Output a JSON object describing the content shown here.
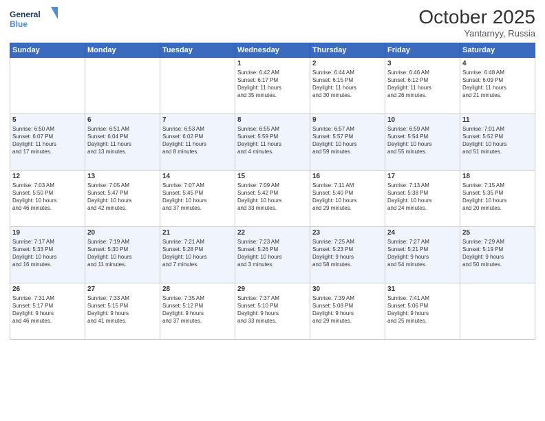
{
  "header": {
    "logo_line1": "General",
    "logo_line2": "Blue",
    "month": "October 2025",
    "location": "Yantarnyy, Russia"
  },
  "days_of_week": [
    "Sunday",
    "Monday",
    "Tuesday",
    "Wednesday",
    "Thursday",
    "Friday",
    "Saturday"
  ],
  "weeks": [
    [
      {
        "num": "",
        "info": ""
      },
      {
        "num": "",
        "info": ""
      },
      {
        "num": "",
        "info": ""
      },
      {
        "num": "1",
        "info": "Sunrise: 6:42 AM\nSunset: 6:17 PM\nDaylight: 11 hours\nand 35 minutes."
      },
      {
        "num": "2",
        "info": "Sunrise: 6:44 AM\nSunset: 6:15 PM\nDaylight: 11 hours\nand 30 minutes."
      },
      {
        "num": "3",
        "info": "Sunrise: 6:46 AM\nSunset: 6:12 PM\nDaylight: 11 hours\nand 26 minutes."
      },
      {
        "num": "4",
        "info": "Sunrise: 6:48 AM\nSunset: 6:09 PM\nDaylight: 11 hours\nand 21 minutes."
      }
    ],
    [
      {
        "num": "5",
        "info": "Sunrise: 6:50 AM\nSunset: 6:07 PM\nDaylight: 11 hours\nand 17 minutes."
      },
      {
        "num": "6",
        "info": "Sunrise: 6:51 AM\nSunset: 6:04 PM\nDaylight: 11 hours\nand 13 minutes."
      },
      {
        "num": "7",
        "info": "Sunrise: 6:53 AM\nSunset: 6:02 PM\nDaylight: 11 hours\nand 8 minutes."
      },
      {
        "num": "8",
        "info": "Sunrise: 6:55 AM\nSunset: 5:59 PM\nDaylight: 11 hours\nand 4 minutes."
      },
      {
        "num": "9",
        "info": "Sunrise: 6:57 AM\nSunset: 5:57 PM\nDaylight: 10 hours\nand 59 minutes."
      },
      {
        "num": "10",
        "info": "Sunrise: 6:59 AM\nSunset: 5:54 PM\nDaylight: 10 hours\nand 55 minutes."
      },
      {
        "num": "11",
        "info": "Sunrise: 7:01 AM\nSunset: 5:52 PM\nDaylight: 10 hours\nand 51 minutes."
      }
    ],
    [
      {
        "num": "12",
        "info": "Sunrise: 7:03 AM\nSunset: 5:50 PM\nDaylight: 10 hours\nand 46 minutes."
      },
      {
        "num": "13",
        "info": "Sunrise: 7:05 AM\nSunset: 5:47 PM\nDaylight: 10 hours\nand 42 minutes."
      },
      {
        "num": "14",
        "info": "Sunrise: 7:07 AM\nSunset: 5:45 PM\nDaylight: 10 hours\nand 37 minutes."
      },
      {
        "num": "15",
        "info": "Sunrise: 7:09 AM\nSunset: 5:42 PM\nDaylight: 10 hours\nand 33 minutes."
      },
      {
        "num": "16",
        "info": "Sunrise: 7:11 AM\nSunset: 5:40 PM\nDaylight: 10 hours\nand 29 minutes."
      },
      {
        "num": "17",
        "info": "Sunrise: 7:13 AM\nSunset: 5:38 PM\nDaylight: 10 hours\nand 24 minutes."
      },
      {
        "num": "18",
        "info": "Sunrise: 7:15 AM\nSunset: 5:35 PM\nDaylight: 10 hours\nand 20 minutes."
      }
    ],
    [
      {
        "num": "19",
        "info": "Sunrise: 7:17 AM\nSunset: 5:33 PM\nDaylight: 10 hours\nand 16 minutes."
      },
      {
        "num": "20",
        "info": "Sunrise: 7:19 AM\nSunset: 5:30 PM\nDaylight: 10 hours\nand 11 minutes."
      },
      {
        "num": "21",
        "info": "Sunrise: 7:21 AM\nSunset: 5:28 PM\nDaylight: 10 hours\nand 7 minutes."
      },
      {
        "num": "22",
        "info": "Sunrise: 7:23 AM\nSunset: 5:26 PM\nDaylight: 10 hours\nand 3 minutes."
      },
      {
        "num": "23",
        "info": "Sunrise: 7:25 AM\nSunset: 5:23 PM\nDaylight: 9 hours\nand 58 minutes."
      },
      {
        "num": "24",
        "info": "Sunrise: 7:27 AM\nSunset: 5:21 PM\nDaylight: 9 hours\nand 54 minutes."
      },
      {
        "num": "25",
        "info": "Sunrise: 7:29 AM\nSunset: 5:19 PM\nDaylight: 9 hours\nand 50 minutes."
      }
    ],
    [
      {
        "num": "26",
        "info": "Sunrise: 7:31 AM\nSunset: 5:17 PM\nDaylight: 9 hours\nand 46 minutes."
      },
      {
        "num": "27",
        "info": "Sunrise: 7:33 AM\nSunset: 5:15 PM\nDaylight: 9 hours\nand 41 minutes."
      },
      {
        "num": "28",
        "info": "Sunrise: 7:35 AM\nSunset: 5:12 PM\nDaylight: 9 hours\nand 37 minutes."
      },
      {
        "num": "29",
        "info": "Sunrise: 7:37 AM\nSunset: 5:10 PM\nDaylight: 9 hours\nand 33 minutes."
      },
      {
        "num": "30",
        "info": "Sunrise: 7:39 AM\nSunset: 5:08 PM\nDaylight: 9 hours\nand 29 minutes."
      },
      {
        "num": "31",
        "info": "Sunrise: 7:41 AM\nSunset: 5:06 PM\nDaylight: 9 hours\nand 25 minutes."
      },
      {
        "num": "",
        "info": ""
      }
    ]
  ]
}
